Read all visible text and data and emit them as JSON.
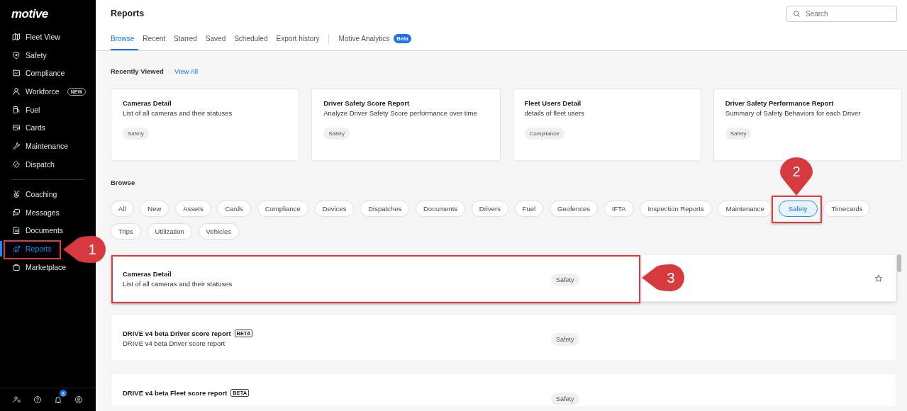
{
  "sidebar": {
    "logo": "motive",
    "sections": [
      [
        {
          "label": "Fleet View",
          "selected": false
        },
        {
          "label": "Safety",
          "selected": false
        },
        {
          "label": "Compliance",
          "selected": false
        },
        {
          "label": "Workforce",
          "selected": false,
          "badge": "NEW"
        },
        {
          "label": "Fuel",
          "selected": false
        },
        {
          "label": "Cards",
          "selected": false
        },
        {
          "label": "Maintenance",
          "selected": false
        },
        {
          "label": "Dispatch",
          "selected": false
        }
      ],
      [
        {
          "label": "Coaching",
          "selected": false
        },
        {
          "label": "Messages",
          "selected": false
        },
        {
          "label": "Documents",
          "selected": false
        },
        {
          "label": "Reports",
          "selected": true
        },
        {
          "label": "Marketplace",
          "selected": false
        }
      ]
    ],
    "notification_count": "8"
  },
  "header": {
    "title": "Reports",
    "search": {
      "placeholder": "Search"
    },
    "tabs": [
      {
        "label": "Browse",
        "selected": true
      },
      {
        "label": "Recent",
        "selected": false
      },
      {
        "label": "Starred",
        "selected": false
      },
      {
        "label": "Saved",
        "selected": false
      },
      {
        "label": "Scheduled",
        "selected": false
      },
      {
        "label": "Export history",
        "selected": false
      },
      {
        "label": "Motive Analytics",
        "selected": false,
        "badge": "Beta",
        "separated": true
      }
    ]
  },
  "recently_viewed": {
    "title": "Recently Viewed",
    "separator": "·",
    "link": "View All",
    "cards": [
      {
        "title": "Cameras Detail",
        "description": "List of all cameras and their statuses",
        "tag": "Safety"
      },
      {
        "title": "Driver Safety Score Report",
        "description": "Analyze Driver Safety Score performance over time",
        "tag": "Safety"
      },
      {
        "title": "Fleet Users Detail",
        "description": "details of fleet users",
        "tag": "Compliance"
      },
      {
        "title": "Driver Safety Performance Report",
        "description": "Summary of Safety Behaviors for each Driver",
        "tag": "Safety"
      }
    ]
  },
  "browse": {
    "title": "Browse",
    "filters": [
      {
        "label": "All",
        "selected": false
      },
      {
        "label": "New",
        "selected": false
      },
      {
        "label": "Assets",
        "selected": false
      },
      {
        "label": "Cards",
        "selected": false
      },
      {
        "label": "Compliance",
        "selected": false
      },
      {
        "label": "Devices",
        "selected": false
      },
      {
        "label": "Dispatches",
        "selected": false
      },
      {
        "label": "Documents",
        "selected": false
      },
      {
        "label": "Drivers",
        "selected": false
      },
      {
        "label": "Fuel",
        "selected": false
      },
      {
        "label": "Geofences",
        "selected": false
      },
      {
        "label": "IFTA",
        "selected": false
      },
      {
        "label": "Inspection Reports",
        "selected": false
      },
      {
        "label": "Maintenance",
        "selected": false
      },
      {
        "label": "Safety",
        "selected": true
      },
      {
        "label": "Timecards",
        "selected": false
      },
      {
        "label": "Trips",
        "selected": false
      },
      {
        "label": "Utilization",
        "selected": false
      },
      {
        "label": "Vehicles",
        "selected": false
      }
    ]
  },
  "reports": [
    {
      "title": "Cameras Detail",
      "description": "List of all cameras and their statuses",
      "tag": "Safety",
      "hovered": true
    },
    {
      "title": "DRIVE v4 beta Driver score report",
      "badge": "BETA",
      "description": "DRIVE v4 beta Driver score report",
      "tag": "Safety",
      "hovered": false
    },
    {
      "title": "DRIVE v4 beta Fleet score report",
      "badge": "BETA",
      "tag": "Safety",
      "hovered": false
    }
  ],
  "annotations": [
    {
      "label": "1",
      "kind": "left"
    },
    {
      "label": "2",
      "kind": "down"
    },
    {
      "label": "3",
      "kind": "left"
    }
  ]
}
